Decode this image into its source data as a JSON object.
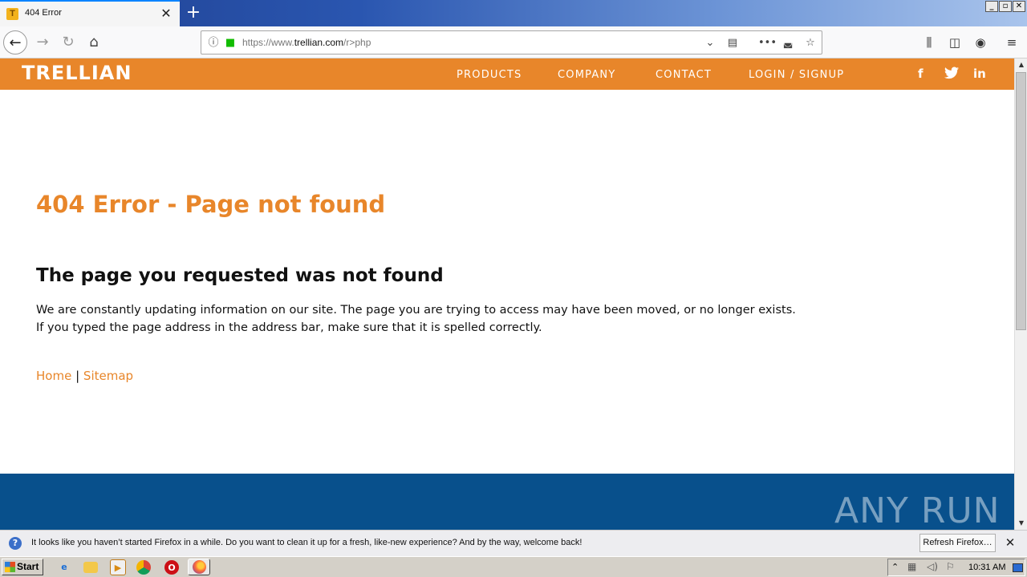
{
  "browser": {
    "tab_title": "404 Error",
    "tab_favicon_letter": "T",
    "new_tab": "+",
    "url_prefix": "https://www.",
    "url_domain": "trellian.com",
    "url_path": "/r>php"
  },
  "site": {
    "logo": "TRELLIAN",
    "nav": [
      "PRODUCTS",
      "COMPANY",
      "CONTACT",
      "LOGIN / SIGNUP"
    ],
    "social": [
      "f",
      "t",
      "in"
    ],
    "accent_color": "#e8862a",
    "footer_color": "#08508c"
  },
  "content": {
    "heading": "404 Error - Page not found",
    "subheading": "The page you requested was not found",
    "line1": "We are constantly updating information on our site. The page you are trying to access may have been moved, or no longer exists.",
    "line2": "If you typed the page address in the address bar, make sure that it is spelled correctly.",
    "link_home": "Home",
    "link_separator": "|",
    "link_sitemap": "Sitemap"
  },
  "watermark": "ANY RUN",
  "notification": {
    "text": "It looks like you haven’t started Firefox in a while. Do you want to clean it up for a fresh, like-new experience? And by the way, welcome back!",
    "button": "Refresh Firefox…"
  },
  "taskbar": {
    "start": "Start",
    "clock": "10:31 AM"
  }
}
